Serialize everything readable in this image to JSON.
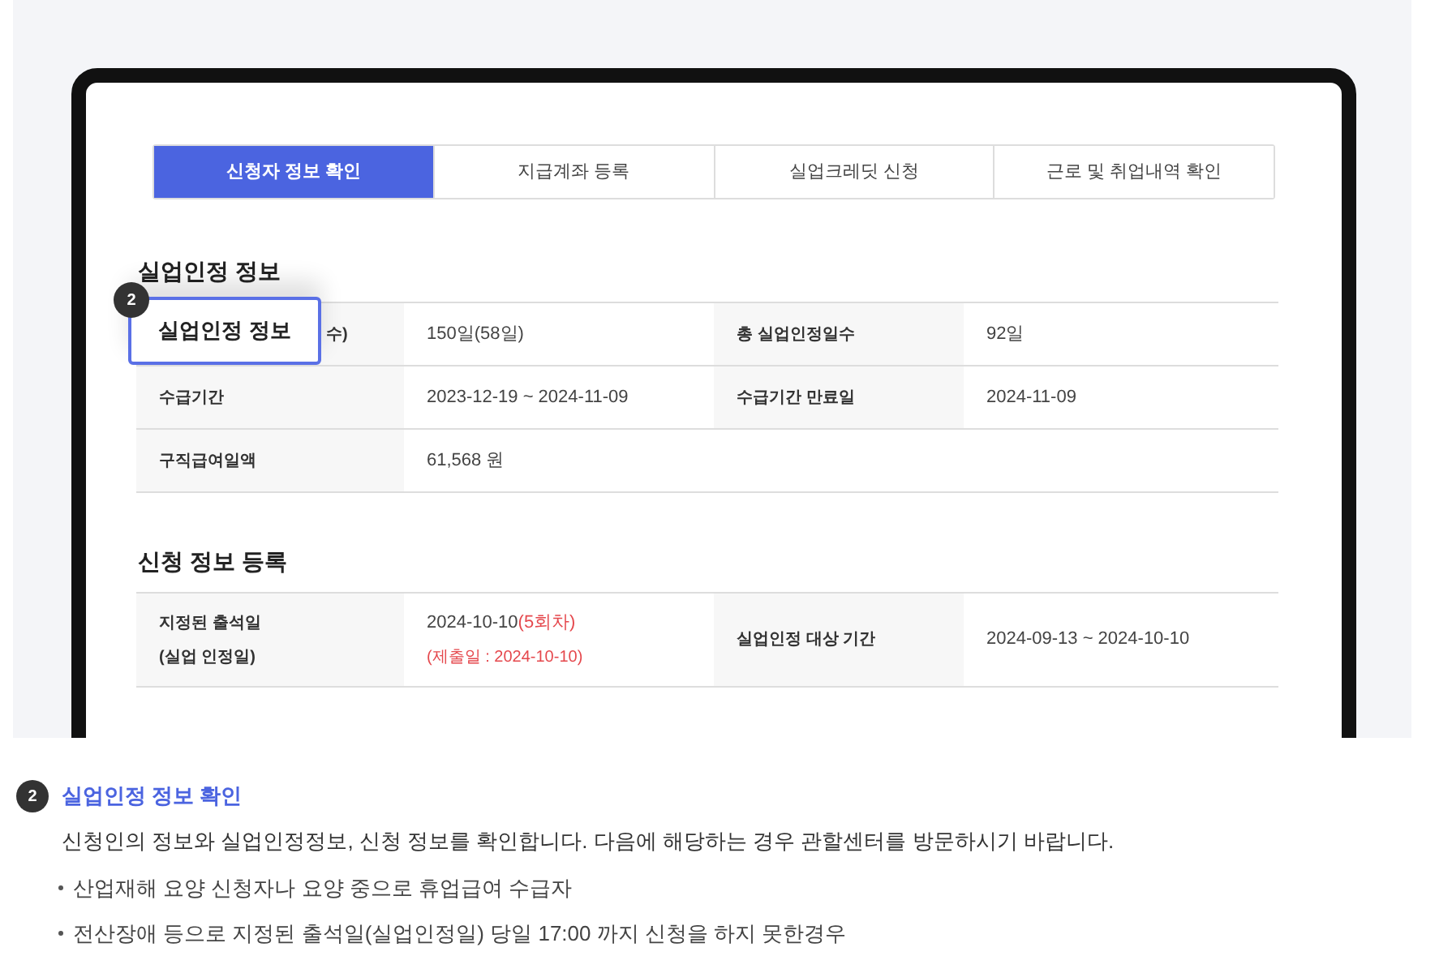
{
  "tabs": [
    {
      "label": "신청자 정보 확인",
      "selected": true
    },
    {
      "label": "지급계좌 등록",
      "selected": false
    },
    {
      "label": "실업크레딧 신청",
      "selected": false
    },
    {
      "label": "근로 및 취업내역 확인",
      "selected": false
    }
  ],
  "sections": [
    {
      "title": "실업인정 정보",
      "rows": [
        {
          "cells": [
            {
              "kind": "label",
              "lines": [
                [
                  {
                    "text": "수)",
                    "highlight": false
                  }
                ]
              ]
            },
            {
              "kind": "value",
              "lines": [
                [
                  {
                    "text": "150일(58일)",
                    "highlight": false
                  }
                ]
              ]
            },
            {
              "kind": "label",
              "lines": [
                [
                  {
                    "text": "총 실업인정일수",
                    "highlight": false
                  }
                ]
              ]
            },
            {
              "kind": "value",
              "lines": [
                [
                  {
                    "text": "92일",
                    "highlight": false
                  }
                ]
              ]
            }
          ]
        },
        {
          "cells": [
            {
              "kind": "label",
              "lines": [
                [
                  {
                    "text": "수급기간",
                    "highlight": false
                  }
                ]
              ]
            },
            {
              "kind": "value",
              "lines": [
                [
                  {
                    "text": "2023-12-19 ~ 2024-11-09",
                    "highlight": false
                  }
                ]
              ]
            },
            {
              "kind": "label",
              "lines": [
                [
                  {
                    "text": "수급기간 만료일",
                    "highlight": false
                  }
                ]
              ]
            },
            {
              "kind": "value",
              "lines": [
                [
                  {
                    "text": "2024-11-09",
                    "highlight": false
                  }
                ]
              ]
            }
          ]
        },
        {
          "cells": [
            {
              "kind": "label",
              "lines": [
                [
                  {
                    "text": "구직급여일액",
                    "highlight": false
                  }
                ]
              ]
            },
            {
              "kind": "value",
              "lines": [
                [
                  {
                    "text": "61,568 원",
                    "highlight": false
                  }
                ]
              ]
            }
          ]
        }
      ]
    },
    {
      "title": "신청 정보 등록",
      "rows": [
        {
          "cells": [
            {
              "kind": "label",
              "lines": [
                [
                  {
                    "text": "지정된 출석일",
                    "highlight": false
                  }
                ],
                [
                  {
                    "text": "(실업 인정일)",
                    "highlight": false
                  }
                ]
              ]
            },
            {
              "kind": "value",
              "lines": [
                [
                  {
                    "text": "2024-10-10",
                    "highlight": false
                  },
                  {
                    "text": "(5회차)",
                    "highlight": true
                  }
                ],
                [
                  {
                    "text": "(제출일 : 2024-10-10)",
                    "highlight": true
                  }
                ]
              ]
            },
            {
              "kind": "label",
              "lines": [
                [
                  {
                    "text": "실업인정 대상 기간",
                    "highlight": false
                  }
                ]
              ]
            },
            {
              "kind": "value",
              "lines": [
                [
                  {
                    "text": "2024-09-13  ~  2024-10-10",
                    "highlight": false
                  }
                ]
              ]
            }
          ]
        }
      ]
    }
  ],
  "callout": {
    "badge": "2",
    "label": "실업인정 정보"
  },
  "description": {
    "badge": "2",
    "title": "실업인정 정보 확인",
    "text": "신청인의 정보와 실업인정정보, 신청 정보를 확인합니다. 다음에 해당하는 경우 관할센터를 방문하시기 바랍니다.",
    "bullets": [
      "산업재해 요양 신청자나 요양 중으로 휴업급여 수급자",
      "전산장애 등으로 지정된 출석일(실업인정일) 당일 17:00 까지 신청을 하지 못한경우"
    ]
  }
}
